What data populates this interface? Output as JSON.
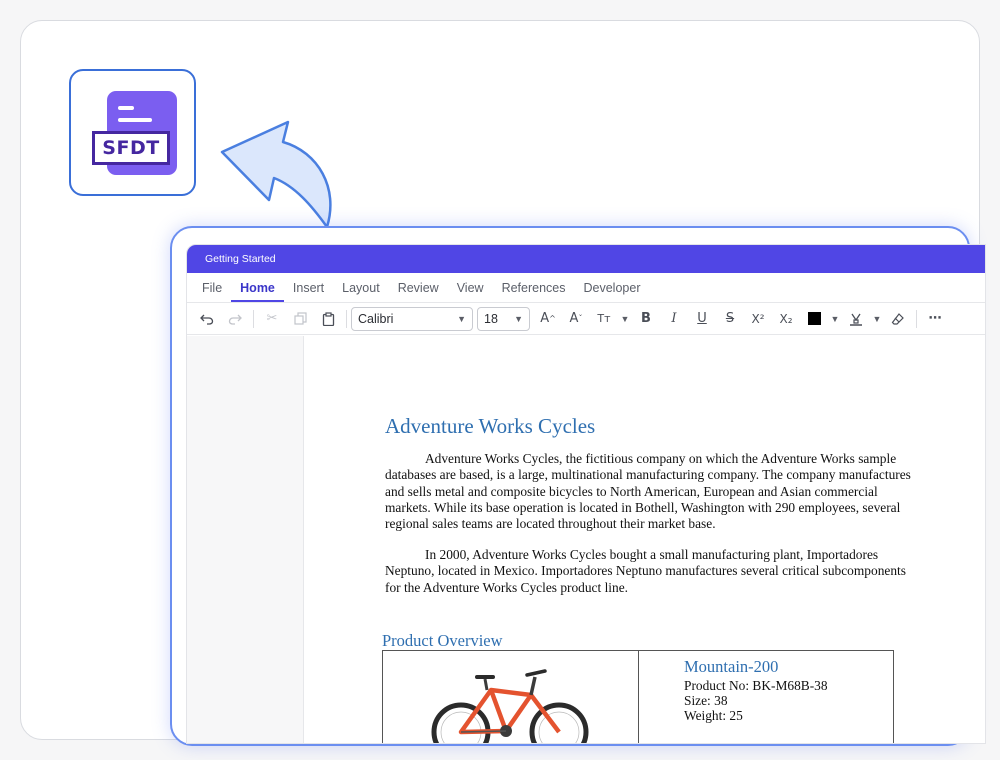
{
  "badge": {
    "label": "SFDT",
    "icon": "sfdt-file-icon"
  },
  "window": {
    "title": "Getting Started"
  },
  "menu": {
    "tabs": [
      {
        "label": "File",
        "active": false
      },
      {
        "label": "Home",
        "active": true
      },
      {
        "label": "Insert",
        "active": false
      },
      {
        "label": "Layout",
        "active": false
      },
      {
        "label": "Review",
        "active": false
      },
      {
        "label": "View",
        "active": false
      },
      {
        "label": "References",
        "active": false
      },
      {
        "label": "Developer",
        "active": false
      }
    ]
  },
  "toolbar": {
    "font_family": "Calibri",
    "font_size": "18",
    "font_color": "#000000",
    "icons": [
      "undo-icon",
      "redo-icon",
      "cut-icon",
      "copy-icon",
      "paste-icon",
      "grow-font-icon",
      "shrink-font-icon",
      "change-case-icon",
      "bold-icon",
      "italic-icon",
      "underline-icon",
      "strikethrough-icon",
      "superscript-icon",
      "subscript-icon",
      "font-color-icon",
      "highlight-icon",
      "clear-format-icon",
      "more-icon"
    ]
  },
  "document": {
    "title": "Adventure Works Cycles",
    "paragraph1": "Adventure Works Cycles, the fictitious company on which the Adventure Works sample databases are based, is a large, multinational manufacturing company. The company manufactures and sells metal and composite bicycles to North American, European and Asian commercial markets. While its base operation is located in Bothell, Washington with 290 employees, several regional sales teams are located throughout their market base.",
    "paragraph2": "In 2000, Adventure Works Cycles bought a small manufacturing plant, Importadores Neptuno, located in Mexico. Importadores Neptuno manufactures several critical subcomponents for the Adventure Works Cycles product line.",
    "section_heading": "Product Overview",
    "product": {
      "name": "Mountain-200",
      "product_no": "Product No: BK-M68B-38",
      "size": "Size: 38",
      "weight": "Weight: 25"
    }
  },
  "colors": {
    "accent": "#5046e5",
    "heading": "#2f6fb0",
    "badge_purple": "#7b5ef0",
    "frame_blue": "#6b8ef0"
  }
}
